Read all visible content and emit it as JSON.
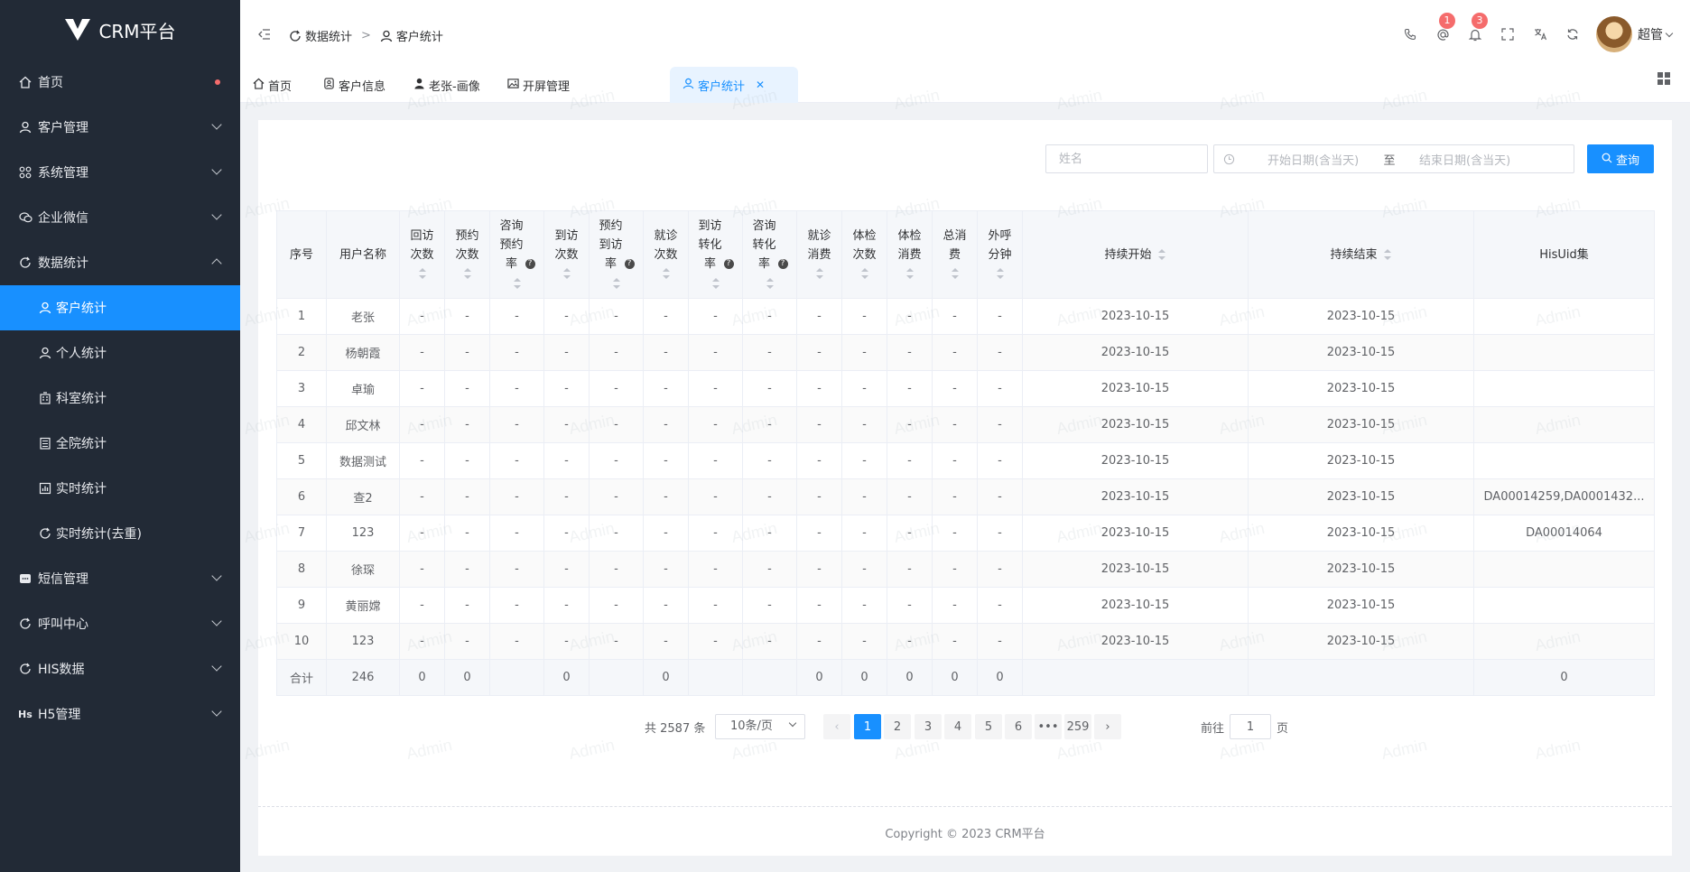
{
  "app": {
    "title": "CRM平台"
  },
  "sidebar": {
    "items": [
      {
        "label": "首页"
      },
      {
        "label": "客户管理"
      },
      {
        "label": "系统管理"
      },
      {
        "label": "企业微信"
      },
      {
        "label": "数据统计"
      },
      {
        "label": "短信管理"
      },
      {
        "label": "呼叫中心"
      },
      {
        "label": "HIS数据"
      },
      {
        "label": "H5管理"
      }
    ],
    "sub_items": [
      {
        "label": "客户统计"
      },
      {
        "label": "个人统计"
      },
      {
        "label": "科室统计"
      },
      {
        "label": "全院统计"
      },
      {
        "label": "实时统计"
      },
      {
        "label": "实时统计(去重)"
      }
    ]
  },
  "header": {
    "breadcrumb": [
      "数据统计",
      "客户统计"
    ],
    "badges": {
      "mention": "1",
      "notice": "3"
    },
    "user_name": "超管"
  },
  "tabs": [
    {
      "label": "首页"
    },
    {
      "label": "客户信息"
    },
    {
      "label": "老张-画像"
    },
    {
      "label": "开屏管理"
    },
    {
      "label": "客户统计"
    }
  ],
  "search": {
    "name_placeholder": "姓名",
    "start_placeholder": "开始日期(含当天)",
    "range_separator": "至",
    "end_placeholder": "结束日期(含当天)",
    "query_label": "查询"
  },
  "table": {
    "headers": [
      "序号",
      "用户名称",
      "回访次数",
      "预约次数",
      "咨询预约率",
      "到访次数",
      "预约到访率",
      "就诊次数",
      "到访转化率",
      "咨询转化率",
      "就诊消费",
      "体检次数",
      "体检消费",
      "总消费",
      "外呼分钟",
      "持续开始",
      "持续结束",
      "HisUid集"
    ],
    "rows": [
      [
        "1",
        "老张",
        "-",
        "-",
        "-",
        "-",
        "-",
        "-",
        "-",
        "-",
        "-",
        "-",
        "-",
        "-",
        "-",
        "2023-10-15",
        "2023-10-15",
        ""
      ],
      [
        "2",
        "杨朝霞",
        "-",
        "-",
        "-",
        "-",
        "-",
        "-",
        "-",
        "-",
        "-",
        "-",
        "-",
        "-",
        "-",
        "2023-10-15",
        "2023-10-15",
        ""
      ],
      [
        "3",
        "卓瑜",
        "-",
        "-",
        "-",
        "-",
        "-",
        "-",
        "-",
        "-",
        "-",
        "-",
        "-",
        "-",
        "-",
        "2023-10-15",
        "2023-10-15",
        ""
      ],
      [
        "4",
        "邱文林",
        "-",
        "-",
        "-",
        "-",
        "-",
        "-",
        "-",
        "-",
        "-",
        "-",
        "-",
        "-",
        "-",
        "2023-10-15",
        "2023-10-15",
        ""
      ],
      [
        "5",
        "数据测试",
        "-",
        "-",
        "-",
        "-",
        "-",
        "-",
        "-",
        "-",
        "-",
        "-",
        "-",
        "-",
        "-",
        "2023-10-15",
        "2023-10-15",
        ""
      ],
      [
        "6",
        "查2",
        "-",
        "-",
        "-",
        "-",
        "-",
        "-",
        "-",
        "-",
        "-",
        "-",
        "-",
        "-",
        "-",
        "2023-10-15",
        "2023-10-15",
        "DA00014259,DA0001432..."
      ],
      [
        "7",
        "123",
        "-",
        "-",
        "-",
        "-",
        "-",
        "-",
        "-",
        "-",
        "-",
        "-",
        "-",
        "-",
        "-",
        "2023-10-15",
        "2023-10-15",
        "DA00014064"
      ],
      [
        "8",
        "徐琛",
        "-",
        "-",
        "-",
        "-",
        "-",
        "-",
        "-",
        "-",
        "-",
        "-",
        "-",
        "-",
        "-",
        "2023-10-15",
        "2023-10-15",
        ""
      ],
      [
        "9",
        "黄丽嫦",
        "-",
        "-",
        "-",
        "-",
        "-",
        "-",
        "-",
        "-",
        "-",
        "-",
        "-",
        "-",
        "-",
        "2023-10-15",
        "2023-10-15",
        ""
      ],
      [
        "10",
        "123",
        "-",
        "-",
        "-",
        "-",
        "-",
        "-",
        "-",
        "-",
        "-",
        "-",
        "-",
        "-",
        "-",
        "2023-10-15",
        "2023-10-15",
        ""
      ]
    ],
    "total_row": [
      "合计",
      "246",
      "0",
      "0",
      "",
      "0",
      "",
      "0",
      "",
      "",
      "0",
      "0",
      "0",
      "0",
      "0",
      "",
      "",
      "0"
    ]
  },
  "pagination": {
    "total_text": "共 2587 条",
    "page_size": "10条/页",
    "pages": [
      "1",
      "2",
      "3",
      "4",
      "5",
      "6",
      "•••",
      "259"
    ],
    "current_page": "1",
    "goto_label": "前往",
    "goto_value": "1",
    "goto_suffix": "页"
  },
  "footer": {
    "text": "Copyright © 2023 CRM平台"
  },
  "watermark": "Admin",
  "colors": {
    "primary": "#1890ff",
    "sidebar_bg": "#222a36",
    "badge": "#f56c6c"
  }
}
